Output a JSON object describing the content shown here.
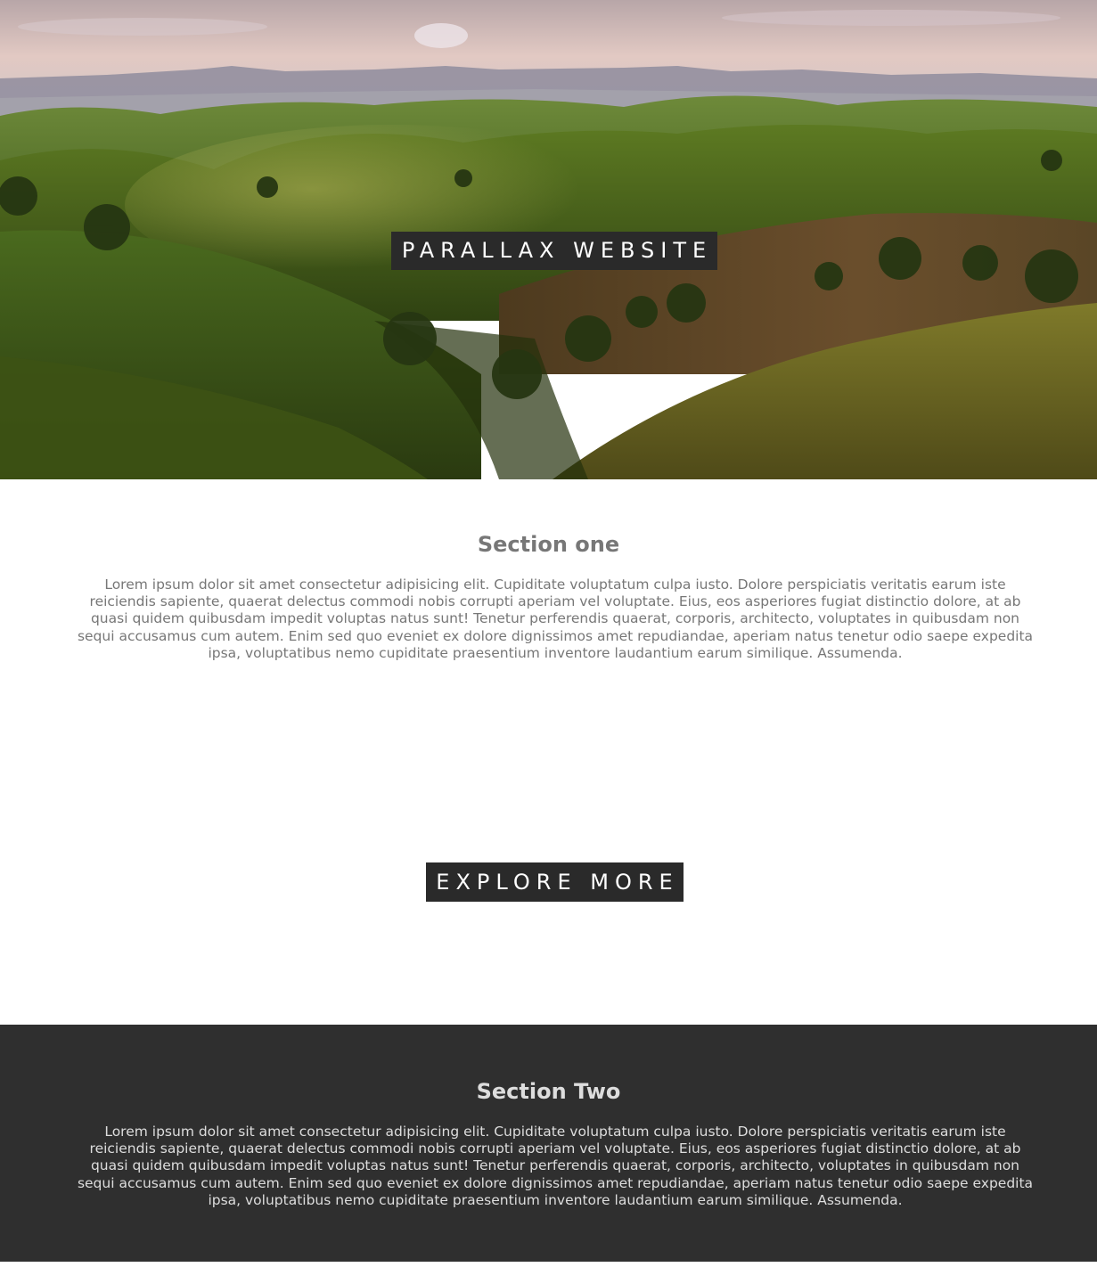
{
  "hero": {
    "title": "PARALLAX WEBSITE",
    "image": "rolling-green-hills-landscape"
  },
  "section_one": {
    "title": "Section one",
    "body": "Lorem ipsum dolor sit amet consectetur adipisicing elit. Cupiditate voluptatum culpa iusto. Dolore perspiciatis veritatis earum iste reiciendis sapiente, quaerat delectus commodi nobis corrupti aperiam vel voluptate. Eius, eos asperiores fugiat distinctio dolore, at ab quasi quidem quibusdam impedit voluptas natus sunt! Tenetur perferendis quaerat, corporis, architecto, voluptates in quibusdam non sequi accusamus cum autem. Enim sed quo eveniet ex dolore dignissimos amet repudiandae, aperiam natus tenetur odio saepe expedita ipsa, voluptatibus nemo cupiditate praesentium inventore laudantium earum similique. Assumenda."
  },
  "explore": {
    "label": "EXPLORE MORE"
  },
  "section_two": {
    "title": "Section Two",
    "body": "Lorem ipsum dolor sit amet consectetur adipisicing elit. Cupiditate voluptatum culpa iusto. Dolore perspiciatis veritatis earum iste reiciendis sapiente, quaerat delectus commodi nobis corrupti aperiam vel voluptate. Eius, eos asperiores fugiat distinctio dolore, at ab quasi quidem quibusdam impedit voluptas natus sunt! Tenetur perferendis quaerat, corporis, architecto, voluptates in quibusdam non sequi accusamus cum autem. Enim sed quo eveniet ex dolore dignissimos amet repudiandae, aperiam natus tenetur odio saepe expedita ipsa, voluptatibus nemo cupiditate praesentium inventore laudantium earum similique. Assumenda."
  },
  "colors": {
    "dark": "#2a2a2a",
    "section_two_bg": "#2f2f2f",
    "muted_text": "#777777",
    "light_text": "#dddddd"
  }
}
